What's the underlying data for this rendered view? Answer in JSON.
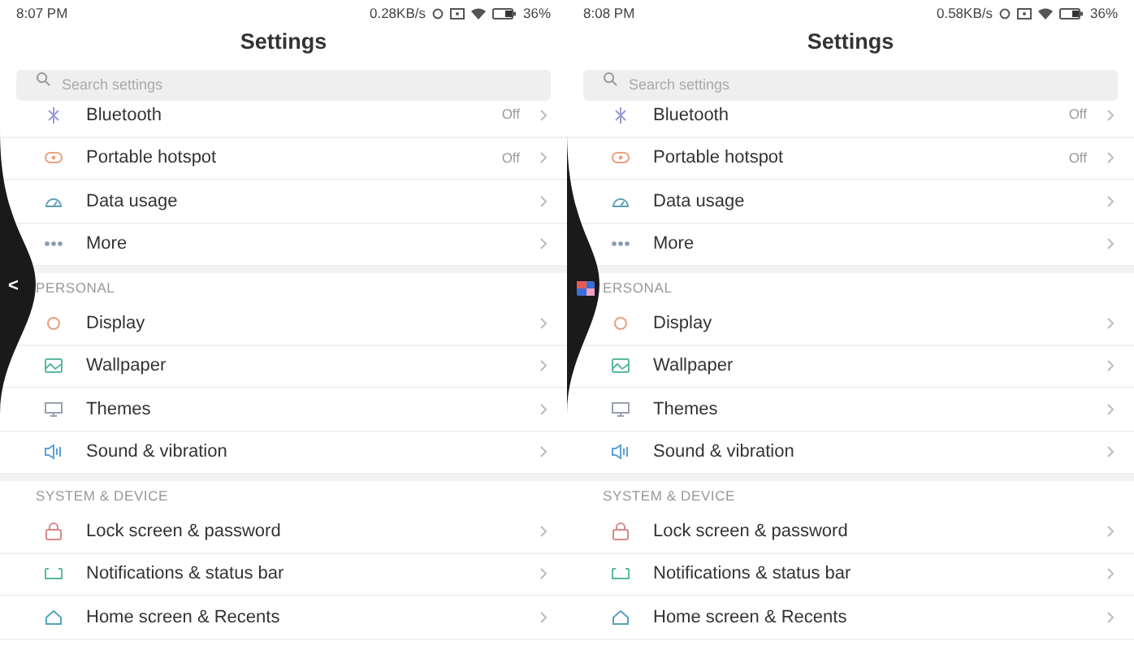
{
  "screens": [
    {
      "status": {
        "time": "8:07 PM",
        "speed": "0.28KB/s",
        "battery": "36%"
      },
      "title": "Settings",
      "search": {
        "placeholder": "Search settings"
      },
      "edge_panel": {
        "kind": "chevron",
        "glyph": "<"
      },
      "sections": [
        {
          "items": [
            {
              "label": "Bluetooth",
              "value": "Off",
              "color": "#9b9bd8"
            },
            {
              "label": "Portable hotspot",
              "value": "Off",
              "color": "#e8a080"
            },
            {
              "label": "Data usage",
              "color": "#5aa0b8"
            },
            {
              "label": "More",
              "color": "#8a9ab0"
            }
          ]
        },
        {
          "header": "PERSONAL",
          "items": [
            {
              "label": "Display",
              "color": "#e8a080"
            },
            {
              "label": "Wallpaper",
              "color": "#5ab8a0"
            },
            {
              "label": "Themes",
              "color": "#9aa0b0"
            },
            {
              "label": "Sound & vibration",
              "color": "#5aa0d8"
            }
          ]
        },
        {
          "header": "SYSTEM & DEVICE",
          "items": [
            {
              "label": "Lock screen & password",
              "color": "#d88888"
            },
            {
              "label": "Notifications & status bar",
              "color": "#5ab8a0"
            },
            {
              "label": "Home screen & Recents",
              "color": "#5aa0b8"
            }
          ]
        }
      ]
    },
    {
      "status": {
        "time": "8:08 PM",
        "speed": "0.58KB/s",
        "battery": "36%"
      },
      "title": "Settings",
      "search": {
        "placeholder": "Search settings"
      },
      "edge_panel": {
        "kind": "app"
      },
      "sections": [
        {
          "items": [
            {
              "label": "Bluetooth",
              "value": "Off",
              "color": "#9b9bd8"
            },
            {
              "label": "Portable hotspot",
              "value": "Off",
              "color": "#e8a080"
            },
            {
              "label": "Data usage",
              "color": "#5aa0b8"
            },
            {
              "label": "More",
              "color": "#8a9ab0"
            }
          ]
        },
        {
          "header": "ERSONAL",
          "items": [
            {
              "label": "Display",
              "color": "#e8a080"
            },
            {
              "label": "Wallpaper",
              "color": "#5ab8a0"
            },
            {
              "label": "Themes",
              "color": "#9aa0b0"
            },
            {
              "label": "Sound & vibration",
              "color": "#5aa0d8"
            }
          ]
        },
        {
          "header": "SYSTEM & DEVICE",
          "items": [
            {
              "label": "Lock screen & password",
              "color": "#d88888"
            },
            {
              "label": "Notifications & status bar",
              "color": "#5ab8a0"
            },
            {
              "label": "Home screen & Recents",
              "color": "#5aa0b8"
            }
          ]
        }
      ]
    }
  ]
}
